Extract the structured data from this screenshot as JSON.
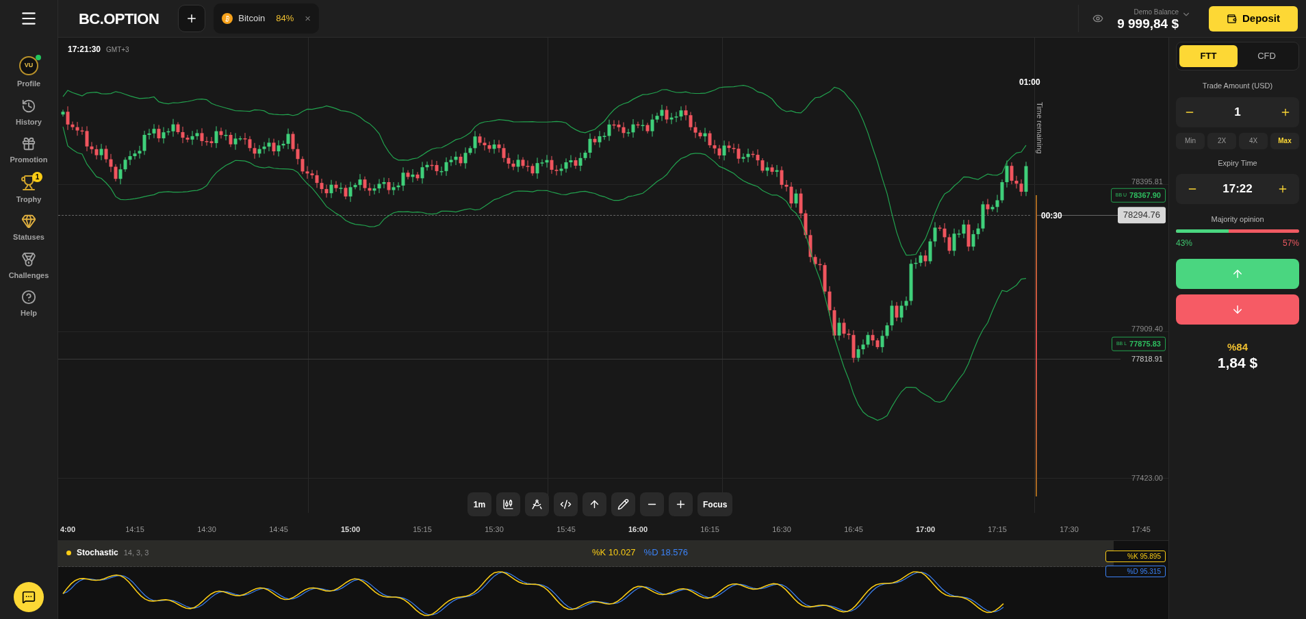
{
  "topbar": {
    "logo": "BC.OPTION",
    "asset_tab": {
      "name": "Bitcoin",
      "payout": "84%",
      "close": "×"
    },
    "balance": {
      "label": "Demo Balance",
      "value": "9 999,84 $"
    },
    "deposit": "Deposit"
  },
  "sidebar": {
    "items": [
      {
        "kind": "avatar",
        "label": "Profile",
        "initials": "VU",
        "online": true
      },
      {
        "kind": "history",
        "label": "History"
      },
      {
        "kind": "gift",
        "label": "Promotion"
      },
      {
        "kind": "trophy",
        "label": "Trophy",
        "badge": "1"
      },
      {
        "kind": "gem",
        "label": "Statuses"
      },
      {
        "kind": "medal",
        "label": "Challenges"
      },
      {
        "kind": "help",
        "label": "Help"
      }
    ]
  },
  "chart": {
    "clock": "17:21:30",
    "timezone": "GMT+3",
    "timer_top": "01:00",
    "time_remaining": "Time remaining",
    "timer_now": "00:30",
    "price_labels": [
      {
        "kind": "grid",
        "value": "78395.81"
      },
      {
        "kind": "band",
        "name": "BB U",
        "value": "78367.90"
      },
      {
        "kind": "current",
        "value": "78294.76"
      },
      {
        "kind": "grid",
        "value": "77909.40"
      },
      {
        "kind": "band",
        "name": "BB L",
        "value": "77875.83"
      },
      {
        "kind": "line",
        "value": "77818.91"
      },
      {
        "kind": "grid",
        "value": "77423.00"
      }
    ],
    "tools": [
      {
        "kind": "label",
        "label": "1m"
      },
      {
        "kind": "icon"
      },
      {
        "kind": "icon"
      },
      {
        "kind": "icon"
      },
      {
        "kind": "icon"
      },
      {
        "kind": "icon"
      },
      {
        "kind": "icon"
      },
      {
        "kind": "icon"
      },
      {
        "kind": "label",
        "label": "Focus"
      }
    ],
    "time_axis": [
      {
        "label": "4:00",
        "bold": true
      },
      {
        "label": "14:15",
        "bold": false
      },
      {
        "label": "14:30",
        "bold": false
      },
      {
        "label": "14:45",
        "bold": false
      },
      {
        "label": "15:00",
        "bold": true
      },
      {
        "label": "15:15",
        "bold": false
      },
      {
        "label": "15:30",
        "bold": false
      },
      {
        "label": "15:45",
        "bold": false
      },
      {
        "label": "16:00",
        "bold": true
      },
      {
        "label": "16:15",
        "bold": false
      },
      {
        "label": "16:30",
        "bold": false
      },
      {
        "label": "16:45",
        "bold": false
      },
      {
        "label": "17:00",
        "bold": true
      },
      {
        "label": "17:15",
        "bold": false
      },
      {
        "label": "17:30",
        "bold": false
      },
      {
        "label": "17:45",
        "bold": false
      }
    ]
  },
  "stochastic": {
    "name": "Stochastic",
    "params": "14, 3, 3",
    "k": "%K 10.027",
    "d": "%D 18.576",
    "k_now": "%K 95.895",
    "d_now": "%D 95.315"
  },
  "panel": {
    "modes": [
      {
        "label": "FTT",
        "selected": true
      },
      {
        "label": "CFD",
        "selected": false
      }
    ],
    "amount": {
      "label": "Trade Amount (USD)",
      "value": "1"
    },
    "multipliers": [
      {
        "label": "Min",
        "selected": false
      },
      {
        "label": "2X",
        "selected": false
      },
      {
        "label": "4X",
        "selected": false
      },
      {
        "label": "Max",
        "selected": true
      }
    ],
    "expiry": {
      "label": "Expiry Time",
      "value": "17:22"
    },
    "majority": {
      "label": "Majority opinion",
      "level": 0.43,
      "up": "43%",
      "down": "57%"
    },
    "payout": {
      "percent": "%84",
      "amount": "1,84 $"
    }
  }
}
